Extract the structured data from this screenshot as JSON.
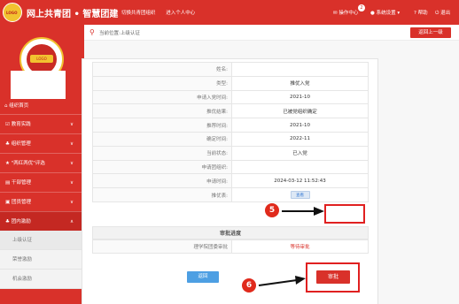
{
  "header": {
    "logo_text": "LOGO",
    "brand_title": "网上共青团 • 智慧团建",
    "nav": [
      "切换共青团组织",
      "进入个人中心"
    ],
    "actions": {
      "operation_center": "操作中心",
      "badge_count": "2",
      "system_settings": "系统设置",
      "help": "帮助",
      "logout": "退出"
    }
  },
  "sidebar": {
    "emblem_text": "LOGO",
    "home": "组织首页",
    "menus": [
      "教育实践",
      "组织管理",
      "\"两红两优\"评选",
      "干部管理",
      "团员管理",
      "团内激励"
    ],
    "submenus": [
      "上级认证",
      "荣誉激励",
      "机会激励"
    ]
  },
  "breadcrumb": {
    "text": "当前位置:上级认证",
    "back_button": "返回上一级"
  },
  "detail_rows": [
    {
      "label": "姓名:",
      "value": ""
    },
    {
      "label": "类型:",
      "value": "推优入党"
    },
    {
      "label": "申请入党时间:",
      "value": "2021-10"
    },
    {
      "label": "推优结果:",
      "value": "已被党组织确定"
    },
    {
      "label": "推荐时间:",
      "value": "2021-10"
    },
    {
      "label": "确定时间:",
      "value": "2022-11"
    },
    {
      "label": "当前状态:",
      "value": "已入党"
    },
    {
      "label": "申请团组织:",
      "value": ""
    },
    {
      "label": "申请时间:",
      "value": "2024-03-12 11:52:43"
    }
  ],
  "evidence": {
    "label": "推优表:",
    "button": "查看"
  },
  "approval": {
    "section_title": "审批进度",
    "label": "理学院团委审批",
    "status": "等待审批"
  },
  "buttons": {
    "return": "返回",
    "approve": "审批"
  },
  "markers": {
    "step5": "5",
    "step6": "6"
  },
  "colors": {
    "brand_red": "#d9312a",
    "annotation_red": "#e02020",
    "return_blue": "#4d9fe3"
  }
}
